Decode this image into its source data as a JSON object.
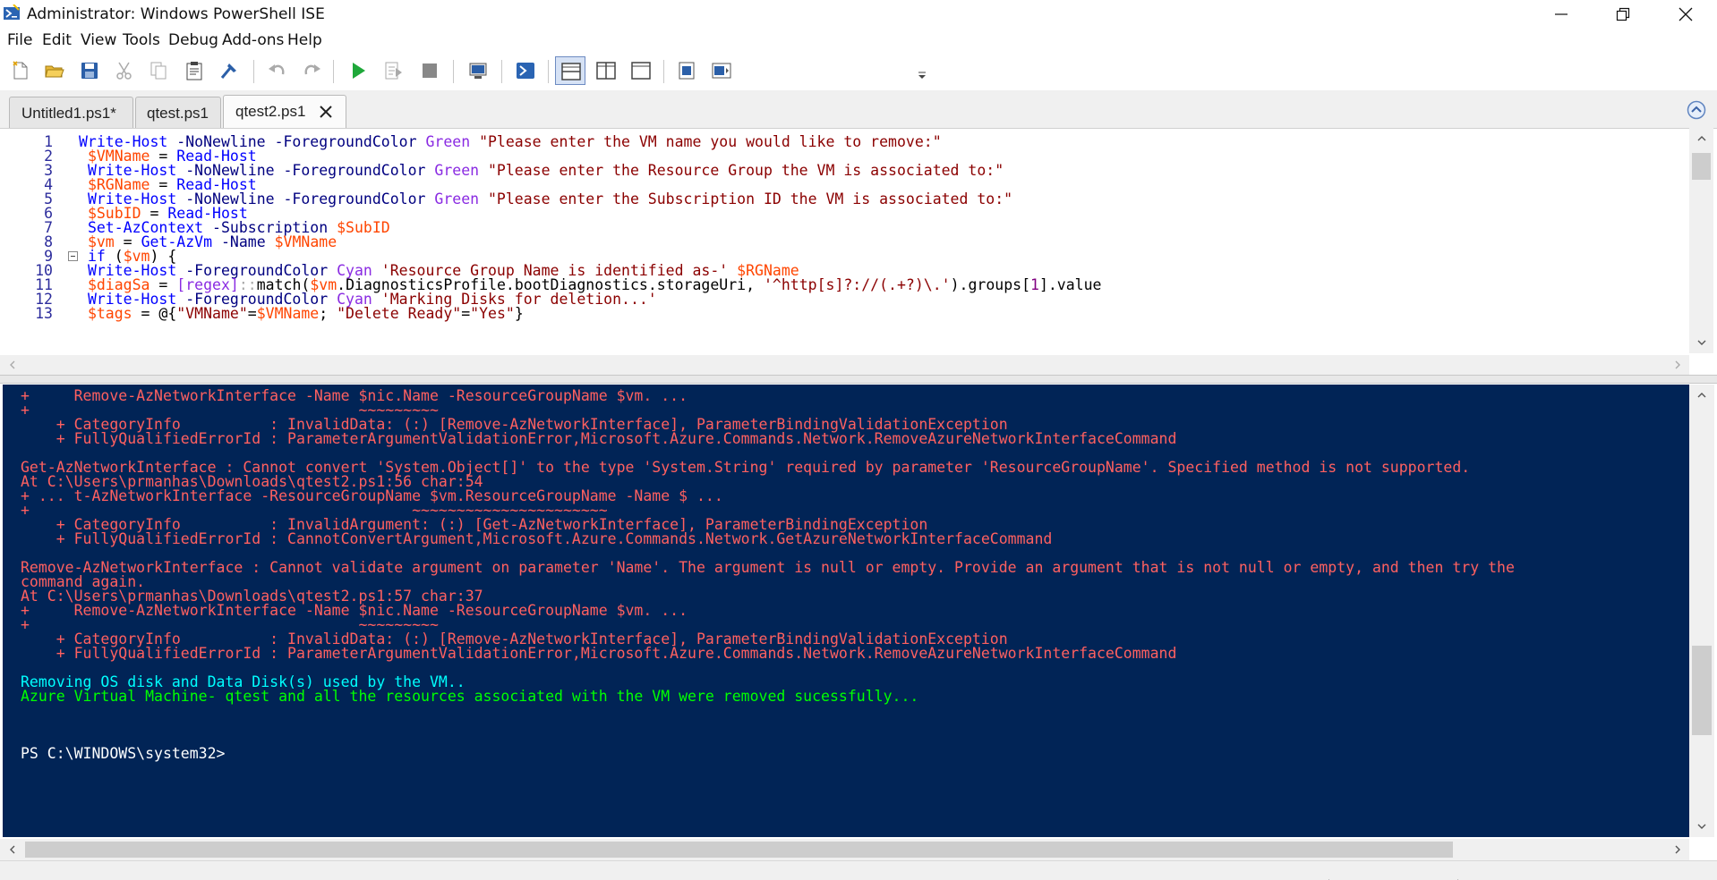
{
  "window": {
    "title": "Administrator: Windows PowerShell ISE",
    "controls": [
      "minimize-icon",
      "maximize-icon",
      "close-icon"
    ]
  },
  "menu": [
    "File",
    "Edit",
    "View",
    "Tools",
    "Debug",
    "Add-ons",
    "Help"
  ],
  "toolbar": {
    "icons": [
      "new-file-icon",
      "open-folder-icon",
      "save-icon",
      "cut-icon",
      "copy-icon",
      "paste-icon",
      "clear-console-icon",
      "undo-icon",
      "redo-icon",
      "run-script-icon",
      "run-selection-icon",
      "stop-icon",
      "new-remote-tab-icon",
      "start-powershell-icon",
      "script-pane-top-icon",
      "script-pane-right-icon",
      "script-pane-maximized-icon",
      "show-script-pane-icon",
      "show-commands-icon",
      "toolbar-overflow-icon"
    ]
  },
  "tabs": [
    {
      "label": "Untitled1.ps1*"
    },
    {
      "label": "qtest.ps1"
    },
    {
      "label": "qtest2.ps1",
      "selected": true
    }
  ],
  "editor": {
    "lines": [
      {
        "n": "1",
        "tokens": [
          [
            "cmd",
            "Write-Host"
          ],
          [
            "plain",
            " "
          ],
          [
            "param",
            "-NoNewline"
          ],
          [
            "plain",
            " "
          ],
          [
            "param",
            "-ForegroundColor"
          ],
          [
            "plain",
            " "
          ],
          [
            "type",
            "Green"
          ],
          [
            "plain",
            " "
          ],
          [
            "str",
            "\"Please enter the VM name you would like to remove:\""
          ]
        ]
      },
      {
        "n": "2",
        "tokens": [
          [
            "plain",
            " "
          ],
          [
            "var",
            "$VMName"
          ],
          [
            "plain",
            " = "
          ],
          [
            "cmd",
            "Read-Host"
          ]
        ]
      },
      {
        "n": "3",
        "tokens": [
          [
            "plain",
            " "
          ],
          [
            "cmd",
            "Write-Host"
          ],
          [
            "plain",
            " "
          ],
          [
            "param",
            "-NoNewline"
          ],
          [
            "plain",
            " "
          ],
          [
            "param",
            "-ForegroundColor"
          ],
          [
            "plain",
            " "
          ],
          [
            "type",
            "Green"
          ],
          [
            "plain",
            " "
          ],
          [
            "str",
            "\"Please enter the Resource Group the VM is associated to:\""
          ]
        ]
      },
      {
        "n": "4",
        "tokens": [
          [
            "plain",
            " "
          ],
          [
            "var",
            "$RGName"
          ],
          [
            "plain",
            " = "
          ],
          [
            "cmd",
            "Read-Host"
          ]
        ]
      },
      {
        "n": "5",
        "tokens": [
          [
            "plain",
            " "
          ],
          [
            "cmd",
            "Write-Host"
          ],
          [
            "plain",
            " "
          ],
          [
            "param",
            "-NoNewline"
          ],
          [
            "plain",
            " "
          ],
          [
            "param",
            "-ForegroundColor"
          ],
          [
            "plain",
            " "
          ],
          [
            "type",
            "Green"
          ],
          [
            "plain",
            " "
          ],
          [
            "str",
            "\"Please enter the Subscription ID the VM is associated to:\""
          ]
        ]
      },
      {
        "n": "6",
        "tokens": [
          [
            "plain",
            " "
          ],
          [
            "var",
            "$SubID"
          ],
          [
            "plain",
            " = "
          ],
          [
            "cmd",
            "Read-Host"
          ]
        ]
      },
      {
        "n": "7",
        "tokens": [
          [
            "plain",
            " "
          ],
          [
            "cmd",
            "Set-AzContext"
          ],
          [
            "plain",
            " "
          ],
          [
            "param",
            "-Subscription"
          ],
          [
            "plain",
            " "
          ],
          [
            "var",
            "$SubID"
          ]
        ]
      },
      {
        "n": "8",
        "tokens": [
          [
            "plain",
            " "
          ],
          [
            "var",
            "$vm"
          ],
          [
            "plain",
            " = "
          ],
          [
            "cmd",
            "Get-AzVm"
          ],
          [
            "plain",
            " "
          ],
          [
            "param",
            "-Name"
          ],
          [
            "plain",
            " "
          ],
          [
            "var",
            "$VMName"
          ]
        ]
      },
      {
        "n": "9",
        "fold": true,
        "tokens": [
          [
            "plain",
            " "
          ],
          [
            "cmd",
            "if"
          ],
          [
            "plain",
            " ("
          ],
          [
            "var",
            "$vm"
          ],
          [
            "plain",
            ") {"
          ]
        ]
      },
      {
        "n": "10",
        "tokens": [
          [
            "plain",
            " "
          ],
          [
            "cmd",
            "Write-Host"
          ],
          [
            "plain",
            " "
          ],
          [
            "param",
            "-ForegroundColor"
          ],
          [
            "plain",
            " "
          ],
          [
            "type",
            "Cyan"
          ],
          [
            "plain",
            " "
          ],
          [
            "str",
            "'Resource Group Name is identified as-'"
          ],
          [
            "plain",
            " "
          ],
          [
            "var",
            "$RGName"
          ]
        ]
      },
      {
        "n": "11",
        "tokens": [
          [
            "plain",
            " "
          ],
          [
            "var",
            "$diagSa"
          ],
          [
            "plain",
            " = "
          ],
          [
            "type",
            "[regex]"
          ],
          [
            "op",
            "::"
          ],
          [
            "plain",
            "match("
          ],
          [
            "var",
            "$vm"
          ],
          [
            "plain",
            ".DiagnosticsProfile.bootDiagnostics.storageUri, "
          ],
          [
            "str",
            "'^http[s]?://(.+?)\\.'"
          ],
          [
            "plain",
            ").groups["
          ],
          [
            "num",
            "1"
          ],
          [
            "plain",
            "].value"
          ]
        ]
      },
      {
        "n": "12",
        "tokens": [
          [
            "plain",
            " "
          ],
          [
            "cmd",
            "Write-Host"
          ],
          [
            "plain",
            " "
          ],
          [
            "param",
            "-ForegroundColor"
          ],
          [
            "plain",
            " "
          ],
          [
            "type",
            "Cyan"
          ],
          [
            "plain",
            " "
          ],
          [
            "str",
            "'Marking Disks for deletion...'"
          ]
        ]
      },
      {
        "n": "13",
        "tokens": [
          [
            "plain",
            " "
          ],
          [
            "var",
            "$tags"
          ],
          [
            "plain",
            " = @{"
          ],
          [
            "str",
            "\"VMName\""
          ],
          [
            "plain",
            "="
          ],
          [
            "var",
            "$VMName"
          ],
          [
            "plain",
            "; "
          ],
          [
            "str",
            "\"Delete Ready\""
          ],
          [
            "plain",
            "="
          ],
          [
            "str",
            "\"Yes\""
          ],
          [
            "plain",
            "}"
          ]
        ]
      }
    ]
  },
  "console": {
    "lines": [
      {
        "style": "err",
        "text": "+     Remove-AzNetworkInterface -Name $nic.Name -ResourceGroupName $vm. ..."
      },
      {
        "style": "err",
        "text": "+                                     ~~~~~~~~~"
      },
      {
        "style": "err",
        "text": "    + CategoryInfo          : InvalidData: (:) [Remove-AzNetworkInterface], ParameterBindingValidationException"
      },
      {
        "style": "err",
        "text": "    + FullyQualifiedErrorId : ParameterArgumentValidationError,Microsoft.Azure.Commands.Network.RemoveAzureNetworkInterfaceCommand"
      },
      {
        "style": "err",
        "text": ""
      },
      {
        "style": "err",
        "text": "Get-AzNetworkInterface : Cannot convert 'System.Object[]' to the type 'System.String' required by parameter 'ResourceGroupName'. Specified method is not supported."
      },
      {
        "style": "err",
        "text": "At C:\\Users\\prmanhas\\Downloads\\qtest2.ps1:56 char:54"
      },
      {
        "style": "err",
        "text": "+ ... t-AzNetworkInterface -ResourceGroupName $vm.ResourceGroupName -Name $ ..."
      },
      {
        "style": "err",
        "text": "+                                           ~~~~~~~~~~~~~~~~~~~~~~"
      },
      {
        "style": "err",
        "text": "    + CategoryInfo          : InvalidArgument: (:) [Get-AzNetworkInterface], ParameterBindingException"
      },
      {
        "style": "err",
        "text": "    + FullyQualifiedErrorId : CannotConvertArgument,Microsoft.Azure.Commands.Network.GetAzureNetworkInterfaceCommand"
      },
      {
        "style": "err",
        "text": ""
      },
      {
        "style": "err",
        "text": "Remove-AzNetworkInterface : Cannot validate argument on parameter 'Name'. The argument is null or empty. Provide an argument that is not null or empty, and then try the"
      },
      {
        "style": "err",
        "text": "command again."
      },
      {
        "style": "err",
        "text": "At C:\\Users\\prmanhas\\Downloads\\qtest2.ps1:57 char:37"
      },
      {
        "style": "err",
        "text": "+     Remove-AzNetworkInterface -Name $nic.Name -ResourceGroupName $vm. ..."
      },
      {
        "style": "err",
        "text": "+                                     ~~~~~~~~~"
      },
      {
        "style": "err",
        "text": "    + CategoryInfo          : InvalidData: (:) [Remove-AzNetworkInterface], ParameterBindingValidationException"
      },
      {
        "style": "err",
        "text": "    + FullyQualifiedErrorId : ParameterArgumentValidationError,Microsoft.Azure.Commands.Network.RemoveAzureNetworkInterfaceCommand"
      },
      {
        "style": "err",
        "text": ""
      },
      {
        "style": "cyan",
        "text": "Removing OS disk and Data Disk(s) used by the VM.."
      },
      {
        "style": "green",
        "text": "Azure Virtual Machine- qtest and all the resources associated with the VM were removed sucessfully..."
      },
      {
        "style": "white",
        "text": ""
      },
      {
        "style": "white",
        "text": ""
      },
      {
        "style": "white",
        "text": ""
      },
      {
        "style": "white",
        "text": "PS C:\\WINDOWS\\system32>"
      }
    ]
  },
  "colors": {
    "console_bg": "#012456",
    "error_text": "#ff6060",
    "cyan_text": "#00ffff",
    "green_text": "#00ff00"
  }
}
